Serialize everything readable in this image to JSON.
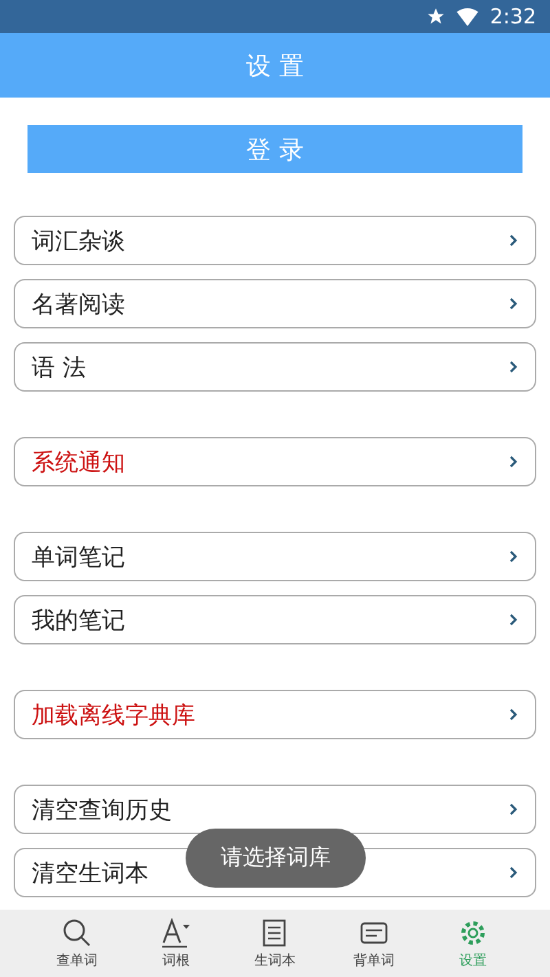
{
  "status_bar": {
    "time": "2:32"
  },
  "header": {
    "title": "设 置"
  },
  "login_button": {
    "label": "登 录"
  },
  "sections": [
    {
      "items": [
        {
          "label": "词汇杂谈",
          "kind": "normal"
        },
        {
          "label": "名著阅读",
          "kind": "normal"
        },
        {
          "label": "语  法",
          "kind": "normal"
        }
      ]
    },
    {
      "items": [
        {
          "label": "系统通知",
          "kind": "notice"
        }
      ]
    },
    {
      "items": [
        {
          "label": "单词笔记",
          "kind": "normal"
        },
        {
          "label": "我的笔记",
          "kind": "normal"
        }
      ]
    },
    {
      "items": [
        {
          "label": "加载离线字典库",
          "kind": "notice"
        }
      ]
    },
    {
      "items": [
        {
          "label": "清空查询历史",
          "kind": "normal"
        },
        {
          "label": "清空生词本",
          "kind": "normal"
        }
      ]
    }
  ],
  "toast": {
    "text": "请选择词库"
  },
  "tab_bar": [
    {
      "label": "查单词",
      "kind": "search",
      "selected": false
    },
    {
      "label": "词根",
      "kind": "font",
      "selected": false
    },
    {
      "label": "生词本",
      "kind": "book",
      "selected": false
    },
    {
      "label": "背单词",
      "kind": "card",
      "selected": false
    },
    {
      "label": "设置",
      "kind": "gear",
      "selected": true
    }
  ]
}
